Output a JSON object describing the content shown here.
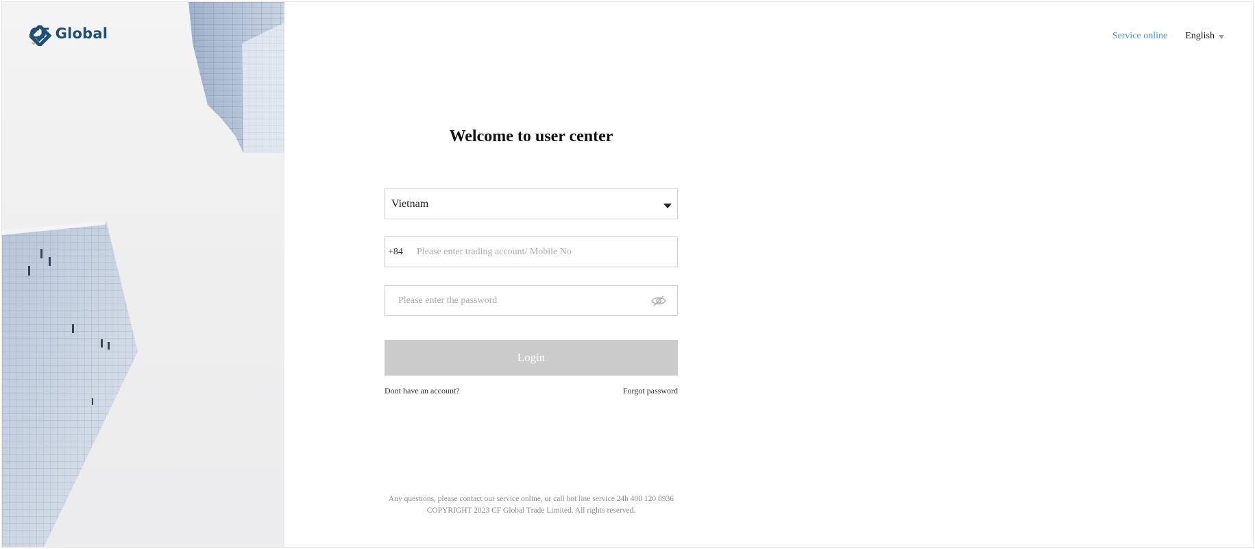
{
  "brand": {
    "logo_text": "CF Global",
    "logo_colors": {
      "primary": "#1e4f7a",
      "accent": "#e8a24a"
    }
  },
  "header": {
    "service_link": "Service online",
    "language": "English"
  },
  "form": {
    "title": "Welcome to user center",
    "country_value": "Vietnam",
    "phone_prefix": "+84",
    "account_placeholder": "Please enter trading account/ Mobile No",
    "password_placeholder": "Please enter the password",
    "login_label": "Login",
    "no_account_link": "Dont have an account?",
    "forgot_password_link": "Forgot password"
  },
  "footer": {
    "contact_line": "Any questions, please contact our service online, or call hot line service 24h 400 120 8936",
    "copyright": "COPYRIGHT 2023 CF Global Trade Limited. All rights reserved."
  },
  "colors": {
    "link_blue": "#4a8fe7",
    "button_disabled": "#cbcbcb",
    "input_border": "#cfcfcf"
  },
  "icons": {
    "logo_mark": "cf-global-logo-icon",
    "select_caret": "caret-down-icon",
    "language_caret": "chevron-down-icon",
    "password_toggle": "eye-off-icon"
  }
}
